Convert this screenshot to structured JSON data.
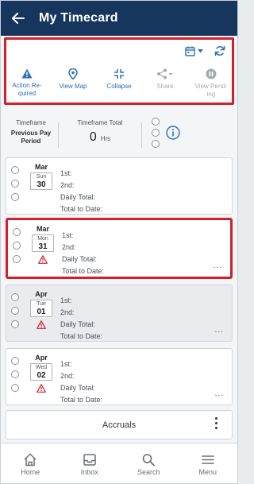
{
  "header": {
    "title": "My Timecard",
    "back_icon": "arrow-left-icon"
  },
  "colors": {
    "header_bg": "#16365d",
    "accent": "#2d6fb5",
    "highlight_border": "#d21f2c",
    "warning": "#d21f2c"
  },
  "toolbar": {
    "top_icons": [
      "calendar-dropdown-icon",
      "refresh-icon"
    ],
    "actions": [
      {
        "label": "Action Re-quired",
        "icon": "warning-icon",
        "enabled": true
      },
      {
        "label": "View Map",
        "icon": "map-pin-icon",
        "enabled": true
      },
      {
        "label": "Collapse",
        "icon": "collapse-icon",
        "enabled": true
      },
      {
        "label": "Share",
        "icon": "share-icon",
        "enabled": false
      },
      {
        "label": "View Pend-ing",
        "icon": "pending-icon",
        "enabled": false
      }
    ]
  },
  "timeframe": {
    "label": "Timeframe",
    "value": "Previous Pay Period",
    "total_label": "Timeframe Total",
    "total_value": "0",
    "total_unit": "Hrs",
    "info_icon": "info-icon"
  },
  "days": [
    {
      "month": "Mar",
      "dow": "Sun",
      "day": "30",
      "warning": false,
      "shaded": false,
      "highlight": false,
      "more": false,
      "fields": [
        "1st:",
        "2nd:",
        "Daily Total:",
        "Total to Date:"
      ]
    },
    {
      "month": "Mar",
      "dow": "Mon",
      "day": "31",
      "warning": true,
      "shaded": false,
      "highlight": true,
      "more": true,
      "fields": [
        "1st:",
        "2nd:",
        "Daily Total:",
        "Total to Date:"
      ]
    },
    {
      "month": "Apr",
      "dow": "Tue",
      "day": "01",
      "warning": true,
      "shaded": true,
      "highlight": false,
      "more": true,
      "fields": [
        "1st:",
        "2nd:",
        "Daily Total:",
        "Total to Date:"
      ]
    },
    {
      "month": "Apr",
      "dow": "Wed",
      "day": "02",
      "warning": true,
      "shaded": false,
      "highlight": false,
      "more": true,
      "fields": [
        "1st:",
        "2nd:",
        "Daily Total:",
        "Total to Date:"
      ]
    }
  ],
  "more_label": "...",
  "accruals": {
    "label": "Accruals"
  },
  "nav": [
    {
      "label": "Home",
      "icon": "home-icon"
    },
    {
      "label": "Inbox",
      "icon": "inbox-icon"
    },
    {
      "label": "Search",
      "icon": "search-icon"
    },
    {
      "label": "Menu",
      "icon": "menu-icon"
    }
  ]
}
